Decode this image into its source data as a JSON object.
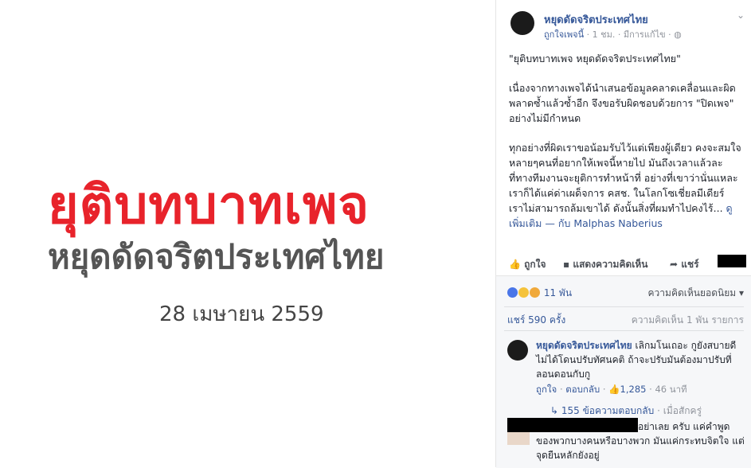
{
  "photo": {
    "line1": "ยุติบทบาทเพจ",
    "line2": "หยุดดัดจริตประเทศไทย",
    "date": "28 เมษายน 2559"
  },
  "post": {
    "page_name": "หยุดดัดจริตประเทศไทย",
    "like_page": "ถูกใจเพจนี้",
    "time": "· 1 ชม. · มีการแก้ไข ·",
    "body_p1": "\"ยุติบทบาทเพจ หยุดดัดจริตประเทศไทย\"",
    "body_p2": "เนื่องจากทางเพจได้นำเสนอข้อมูลคลาดเคลื่อนและผิดพลาดซ้ำแล้วซ้ำอีก จึงขอรับผิดชอบด้วยการ \"ปิดเพจ\" อย่างไม่มีกำหนด",
    "body_p3": "ทุกอย่างที่ผิดเราขอน้อมรับไว้แต่เพียงผู้เดียว คงจะสมใจหลายๆคนที่อยากให้เพจนี้หายไป มันถึงเวลาแล้วละที่ทางทีมงานจะยุติการทำหน้าที่ อย่างที่เขาว่านั่นแหละ เราก็ได้แค่ด่าเผด็จการ คสช. ในโลกโซเชี่ยลมีเดียร์ เราไม่สามารถล้มเขาได้ ดังนั้นสิ่งที่ผมทำไปคงไร้...",
    "see_more": "ดูเพิ่มเติม",
    "with_text": "— กับ Malphas Naberius"
  },
  "actions": {
    "like": "ถูกใจ",
    "comment": "แสดงความคิดเห็น",
    "share": "แชร์"
  },
  "stats": {
    "reactions": "11 พัน",
    "sort": "ความคิดเห็นยอดนิยม",
    "shares": "แชร์ 590 ครั้ง",
    "comments": "ความคิดเห็น 1 พัน รายการ"
  },
  "comment1": {
    "author": "หยุดดัดจริตประเทศไทย",
    "text": "เลิกมโนเถอะ กูยังสบายดี ไม่ได้โดนปรับทัศนคติ ถ้าจะปรับมันต้องมาปรับที่ลอนดอนกับกู",
    "like": "ถูกใจ",
    "reply": "ตอบกลับ",
    "likes": "1,285",
    "time": "46 นาที",
    "replies": "155 ข้อความตอบกลับ",
    "reply_time": "· เมื่อสักครู่"
  },
  "comment2": {
    "text": "อย่าเลย ครับ แค่คำพูดของพวกบางคนหรือบางพวก มันแค่กระทบจิตใจ แต่จุดยืนหลักยังอยู่"
  }
}
